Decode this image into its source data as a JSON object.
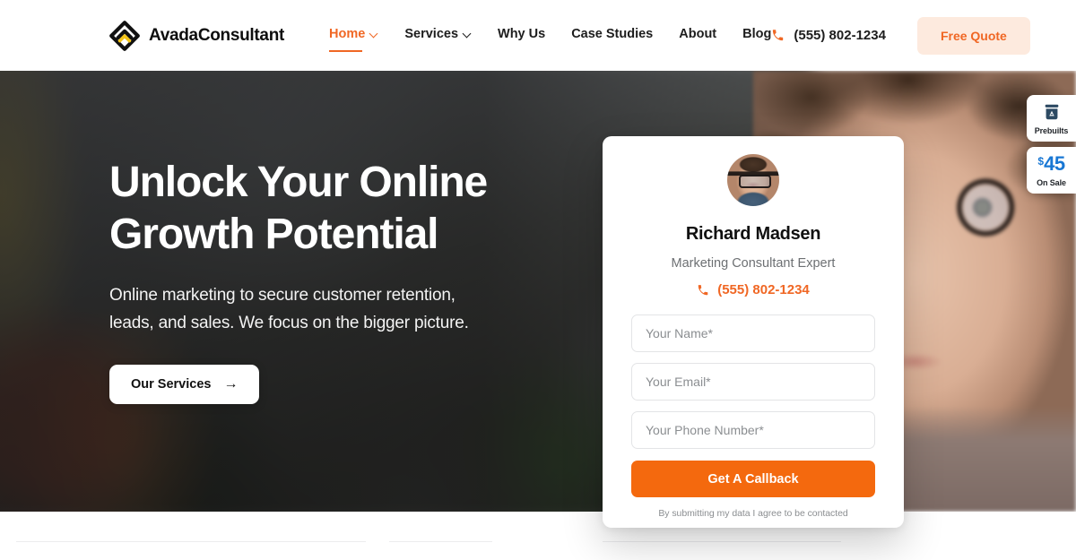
{
  "header": {
    "brand_name": "AvadaConsultant",
    "logo_icon": "avada-diamond-logo",
    "nav": [
      {
        "label": "Home",
        "has_caret": true,
        "active": true
      },
      {
        "label": "Services",
        "has_caret": true,
        "active": false
      },
      {
        "label": "Why Us",
        "has_caret": false,
        "active": false
      },
      {
        "label": "Case Studies",
        "has_caret": false,
        "active": false
      },
      {
        "label": "About",
        "has_caret": false,
        "active": false
      },
      {
        "label": "Blog",
        "has_caret": false,
        "active": false
      }
    ],
    "phone": "(555) 802-1234",
    "phone_icon": "phone-icon",
    "quote_button": "Free Quote",
    "accent_color": "#f06724",
    "quote_bg_color": "#fdeade"
  },
  "hero": {
    "title_line1": "Unlock Your Online",
    "title_line2": "Growth Potential",
    "subtitle_line1": "Online marketing to secure customer retention,",
    "subtitle_line2": "leads, and sales. We focus on the bigger picture.",
    "cta_label": "Our Services",
    "cta_arrow": "→"
  },
  "contact_card": {
    "avatar_name": "consultant-avatar",
    "name": "Richard Madsen",
    "role": "Marketing Consultant Expert",
    "phone": "(555) 802-1234",
    "phone_icon": "phone-icon",
    "fields": [
      {
        "name": "name",
        "placeholder": "Your Name*",
        "value": ""
      },
      {
        "name": "email",
        "placeholder": "Your Email*",
        "value": ""
      },
      {
        "name": "phone",
        "placeholder": "Your Phone Number*",
        "value": ""
      }
    ],
    "submit_label": "Get A Callback",
    "submit_color": "#f4690e",
    "disclaimer": "By submitting my data I agree to be contacted"
  },
  "widgets": [
    {
      "id": "prebuilts",
      "icon": "prebuilts-icon",
      "label": "Prebuilts"
    },
    {
      "id": "on-sale",
      "currency": "$",
      "amount": "45",
      "label": "On Sale",
      "color": "#1877d4"
    }
  ]
}
